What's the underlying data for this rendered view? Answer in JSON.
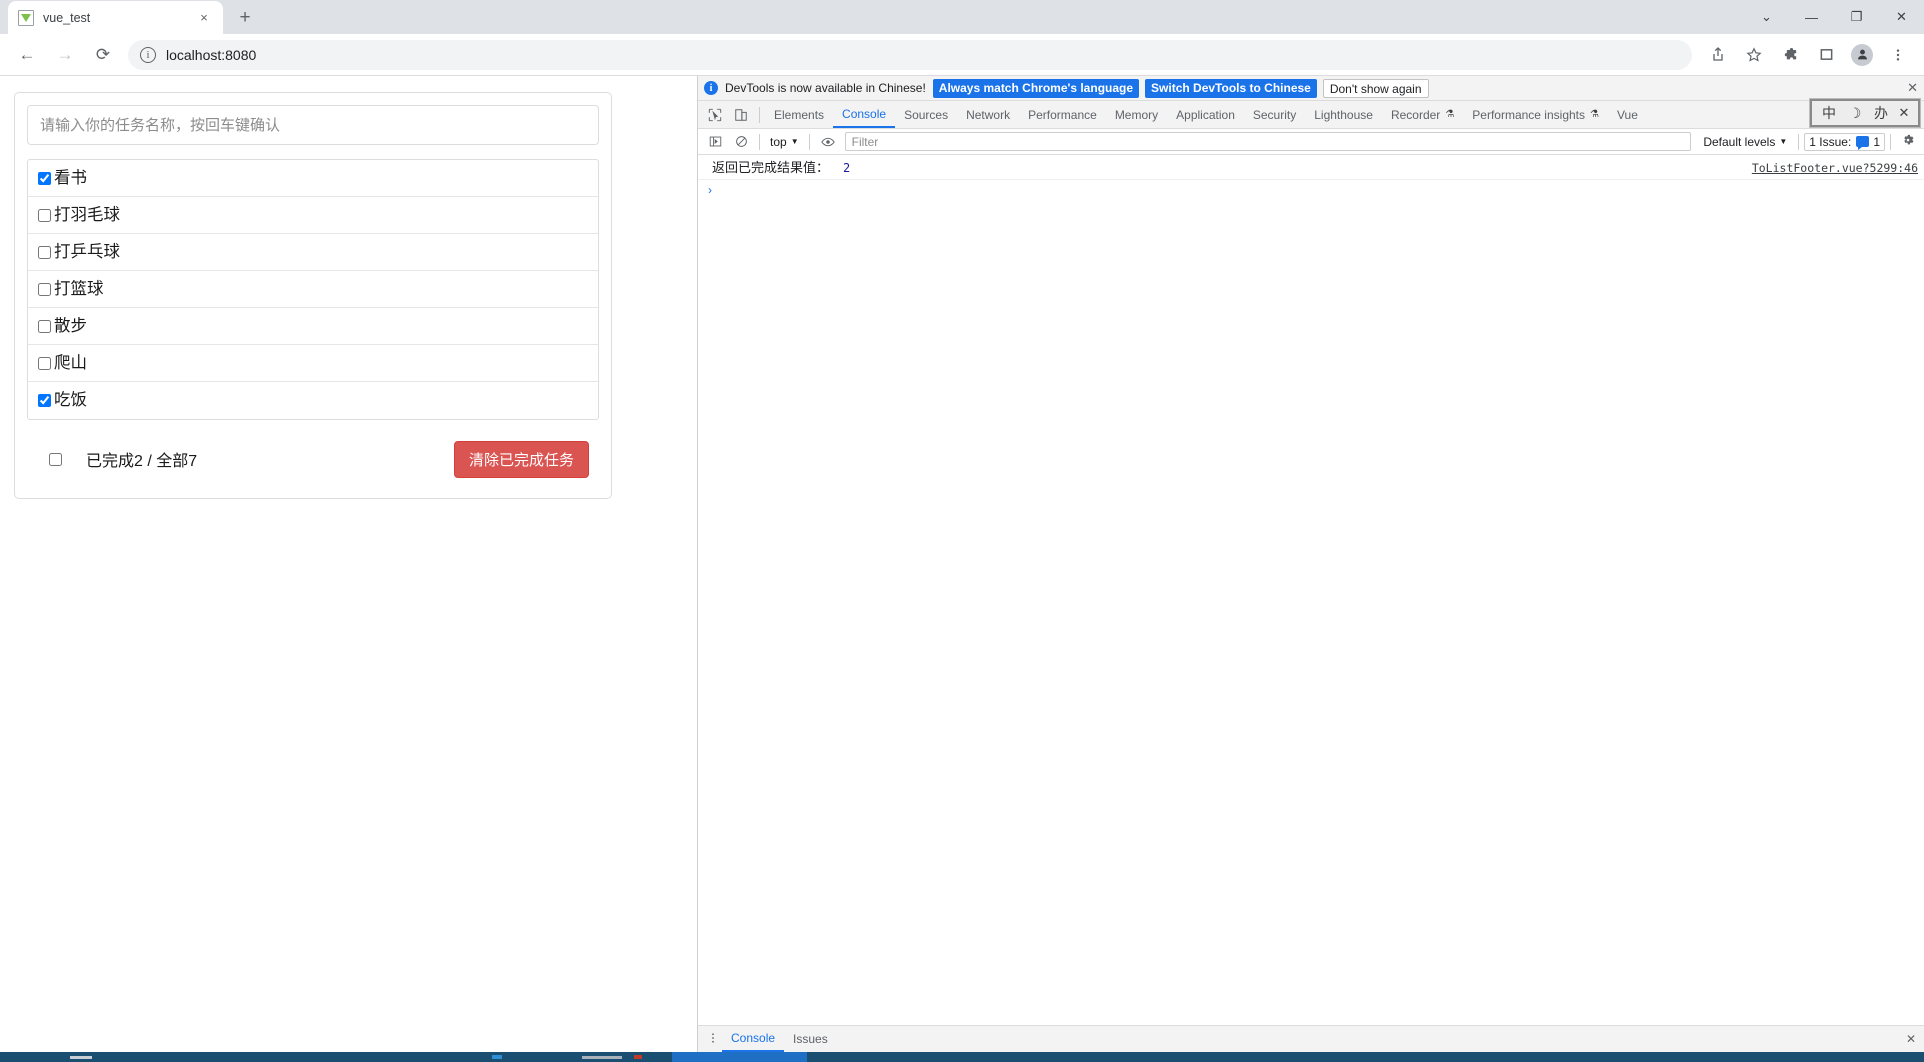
{
  "browser": {
    "tab": {
      "title": "vue_test",
      "favicon": "vue-logo-icon",
      "close": "×"
    },
    "newtab_label": "+",
    "window_controls": {
      "minimize_chevron": "⌄",
      "minimize": "—",
      "maximize": "❐",
      "close": "✕"
    },
    "nav": {
      "back": "←",
      "forward": "→",
      "reload": "⟳"
    },
    "omnibox": {
      "url": "localhost:8080",
      "info_icon": "i"
    },
    "toolbar_icons": [
      "share-icon",
      "bookmark-star-icon",
      "extensions-puzzle-icon",
      "side-panel-icon",
      "profile-avatar",
      "chrome-menu-icon"
    ]
  },
  "page": {
    "input_placeholder": "请输入你的任务名称，按回车键确认",
    "input_value": "",
    "todos": [
      {
        "label": "看书",
        "done": true
      },
      {
        "label": "打羽毛球",
        "done": false
      },
      {
        "label": "打乒乓球",
        "done": false
      },
      {
        "label": "打篮球",
        "done": false
      },
      {
        "label": "散步",
        "done": false
      },
      {
        "label": "爬山",
        "done": false
      },
      {
        "label": "吃饭",
        "done": true
      }
    ],
    "footer": {
      "select_all_checked": false,
      "summary": "已完成2 / 全部7",
      "done_count": 2,
      "total_count": 7,
      "clear_button": "清除已完成任务",
      "clear_button_color": "#da5452"
    }
  },
  "devtools": {
    "banner": {
      "message": "DevTools is now available in Chinese!",
      "primary_button": "Always match Chrome's language",
      "secondary_button": "Switch DevTools to Chinese",
      "dismiss_button": "Don't show again",
      "close": "✕",
      "accent": "#1a73e8"
    },
    "tabs": [
      {
        "label": "Elements",
        "active": false,
        "warn": false
      },
      {
        "label": "Console",
        "active": true,
        "warn": false
      },
      {
        "label": "Sources",
        "active": false,
        "warn": false
      },
      {
        "label": "Network",
        "active": false,
        "warn": false
      },
      {
        "label": "Performance",
        "active": false,
        "warn": false
      },
      {
        "label": "Memory",
        "active": false,
        "warn": false
      },
      {
        "label": "Application",
        "active": false,
        "warn": false
      },
      {
        "label": "Security",
        "active": false,
        "warn": false
      },
      {
        "label": "Lighthouse",
        "active": false,
        "warn": false
      },
      {
        "label": "Recorder",
        "active": false,
        "warn": true
      },
      {
        "label": "Performance insights",
        "active": false,
        "warn": true
      },
      {
        "label": "Vue",
        "active": false,
        "warn": false
      }
    ],
    "tab_right": {
      "message_count": "1"
    },
    "ime_overlay": {
      "mode": "中",
      "icon2": "☽",
      "icon3": "办",
      "close": "✕"
    },
    "filterbar": {
      "context": "top",
      "filter_placeholder": "Filter",
      "filter_value": "",
      "levels": "Default levels",
      "issue_text": "1 Issue:",
      "issue_count": "1",
      "settings_icon": "gear-icon"
    },
    "console": {
      "entries": [
        {
          "message": "返回已完成结果值：",
          "value": "2",
          "source": "ToListFooter.vue?5299:46"
        }
      ],
      "prompt": "›"
    },
    "drawer_tabs": [
      {
        "label": "Console",
        "active": true
      },
      {
        "label": "Issues",
        "active": false
      }
    ],
    "drawer_close": "✕"
  }
}
